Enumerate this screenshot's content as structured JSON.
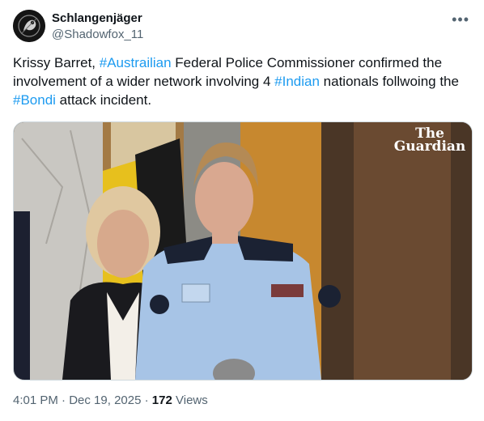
{
  "tweet": {
    "author_name": "Schlangenjäger",
    "handle": "@Shadowfox_11",
    "more_icon": "more-horizontal-icon",
    "text_parts": [
      {
        "t": "Krissy Barret, ",
        "tag": false
      },
      {
        "t": "#Austrailian",
        "tag": true
      },
      {
        "t": " Federal Police Commissioner confirmed the involvement of a wider network involving 4 ",
        "tag": false
      },
      {
        "t": "#Indian",
        "tag": true
      },
      {
        "t": " nationals follwoing the ",
        "tag": false
      },
      {
        "t": "#Bondi",
        "tag": true
      },
      {
        "t": " attack incident.",
        "tag": false
      }
    ],
    "media": {
      "watermark_line1": "The",
      "watermark_line2": "Guardian"
    },
    "time": "4:01 PM",
    "separator": "·",
    "date": "Dec 19, 2025",
    "views_count": "172",
    "views_label": "Views"
  },
  "colors": {
    "accent": "#1d9bf0",
    "text": "#0f1419",
    "muted": "#536471"
  }
}
